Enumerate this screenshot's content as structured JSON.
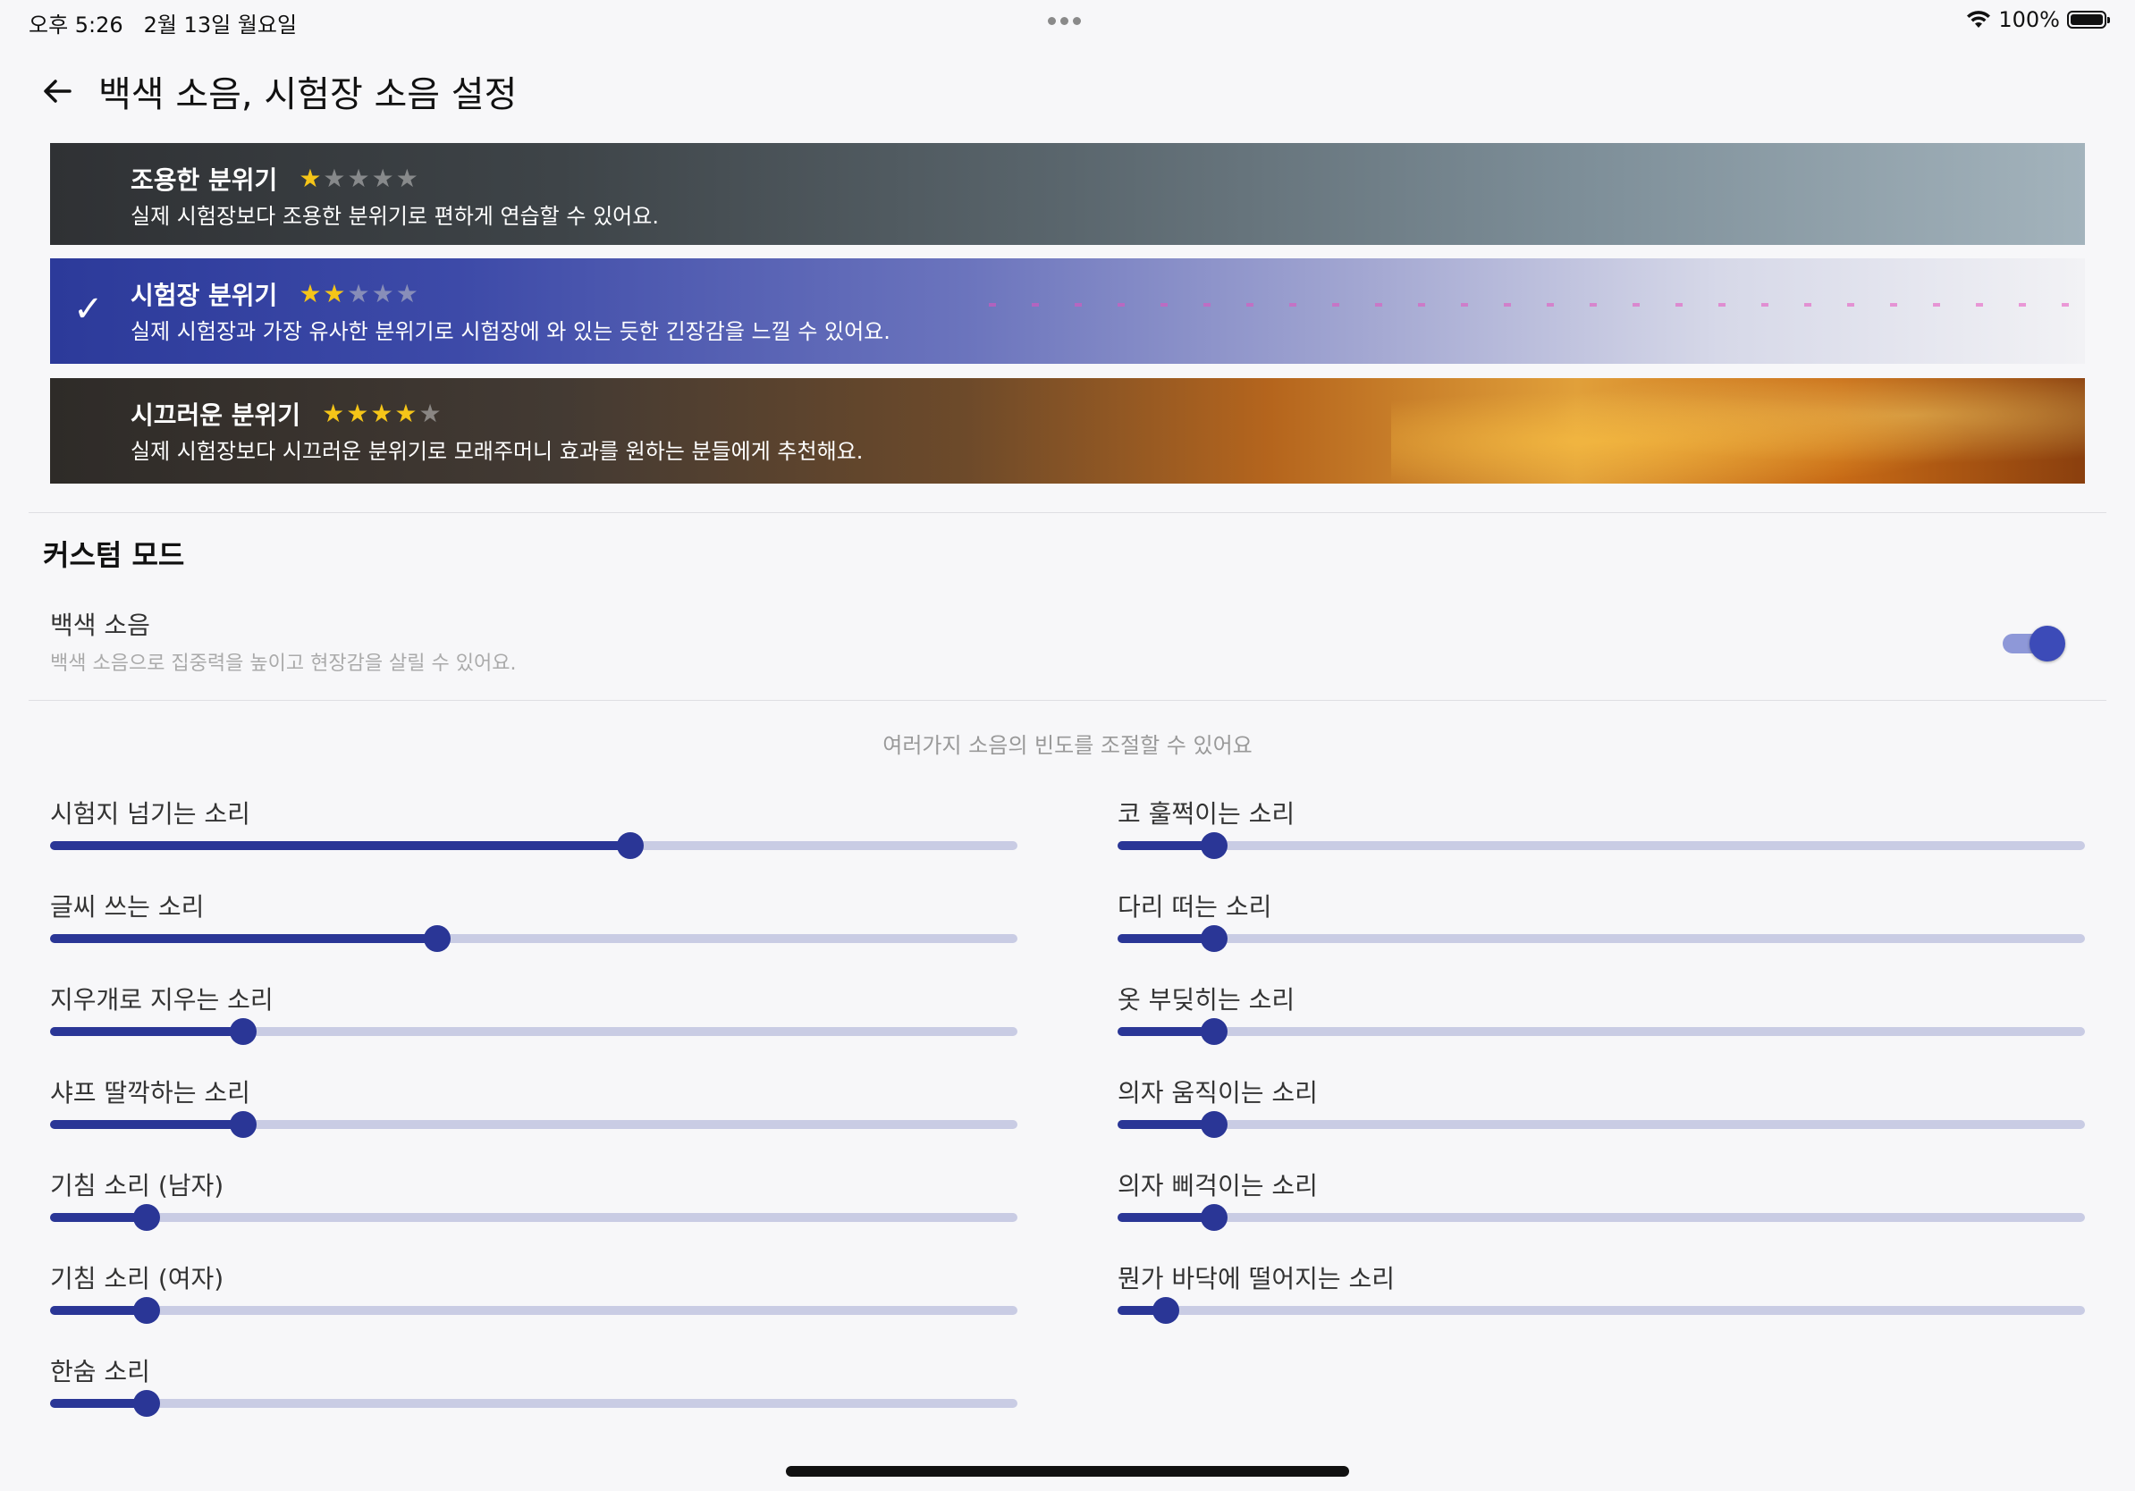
{
  "status_bar": {
    "time": "오후 5:26",
    "date": "2월 13일 월요일",
    "battery": "100%"
  },
  "header": {
    "title": "백색 소음, 시험장 소음 설정",
    "back_icon": "arrow-left-icon"
  },
  "presets": [
    {
      "title": "조용한 분위기",
      "rating": 1,
      "max_rating": 5,
      "description": "실제 시험장보다 조용한 분위기로 편하게 연습할 수 있어요.",
      "selected": false
    },
    {
      "title": "시험장 분위기",
      "rating": 2,
      "max_rating": 5,
      "description": "실제 시험장과 가장 유사한 분위기로 시험장에 와 있는 듯한 긴장감을 느낄 수 있어요.",
      "selected": true
    },
    {
      "title": "시끄러운 분위기",
      "rating": 4,
      "max_rating": 5,
      "description": "실제 시험장보다 시끄러운 분위기로 모래주머니 효과를 원하는 분들에게 추천해요.",
      "selected": false
    }
  ],
  "custom_mode": {
    "title": "커스텀 모드",
    "white_noise_label": "백색 소음",
    "white_noise_description": "백색 소음으로 집중력을 높이고 현장감을 살릴 수 있어요.",
    "white_noise_on": true,
    "frequency_caption": "여러가지 소음의 빈도를 조절할 수 있어요"
  },
  "sliders_left": [
    {
      "label": "시험지 넘기는 소리",
      "value": 0.6
    },
    {
      "label": "글씨 쓰는 소리",
      "value": 0.4
    },
    {
      "label": "지우개로 지우는 소리",
      "value": 0.2
    },
    {
      "label": "샤프 딸깍하는 소리",
      "value": 0.2
    },
    {
      "label": "기침 소리 (남자)",
      "value": 0.1
    },
    {
      "label": "기침 소리 (여자)",
      "value": 0.1
    },
    {
      "label": "한숨 소리",
      "value": 0.1
    }
  ],
  "sliders_right": [
    {
      "label": "코 훌쩍이는 소리",
      "value": 0.1
    },
    {
      "label": "다리 떠는 소리",
      "value": 0.1
    },
    {
      "label": "옷 부딪히는 소리",
      "value": 0.1
    },
    {
      "label": "의자 움직이는 소리",
      "value": 0.1
    },
    {
      "label": "의자 삐걱이는 소리",
      "value": 0.1
    },
    {
      "label": "뭔가 바닥에 떨어지는 소리",
      "value": 0.05
    }
  ],
  "colors": {
    "accent": "#2a3696",
    "track": "#c9cce4",
    "star": "#f5c518"
  }
}
